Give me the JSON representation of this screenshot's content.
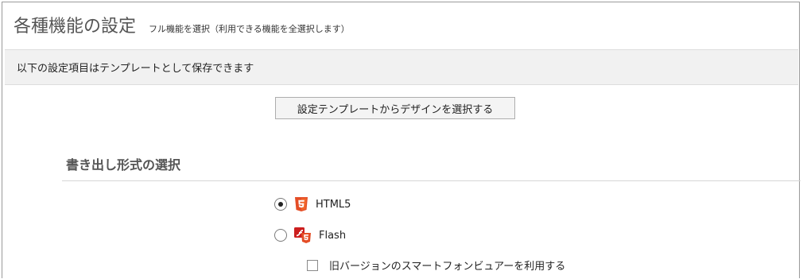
{
  "header": {
    "title": "各種機能の設定",
    "subtitle": "フル機能を選択（利用できる機能を全選択します）"
  },
  "info_bar": {
    "text": "以下の設定項目はテンプレートとして保存できます"
  },
  "template_button": {
    "label": "設定テンプレートからデザインを選択する"
  },
  "output_format": {
    "heading": "書き出し形式の選択",
    "options": [
      {
        "label": "HTML5",
        "icon": "html5-icon",
        "selected": true
      },
      {
        "label": "Flash",
        "icon": "flash-html5-icon",
        "selected": false
      }
    ],
    "legacy_viewer": {
      "label": "旧バージョンのスマートフォンビュアーを利用する",
      "checked": false
    }
  },
  "colors": {
    "html5_orange": "#e44d26",
    "flash_red": "#cc1f1f"
  }
}
